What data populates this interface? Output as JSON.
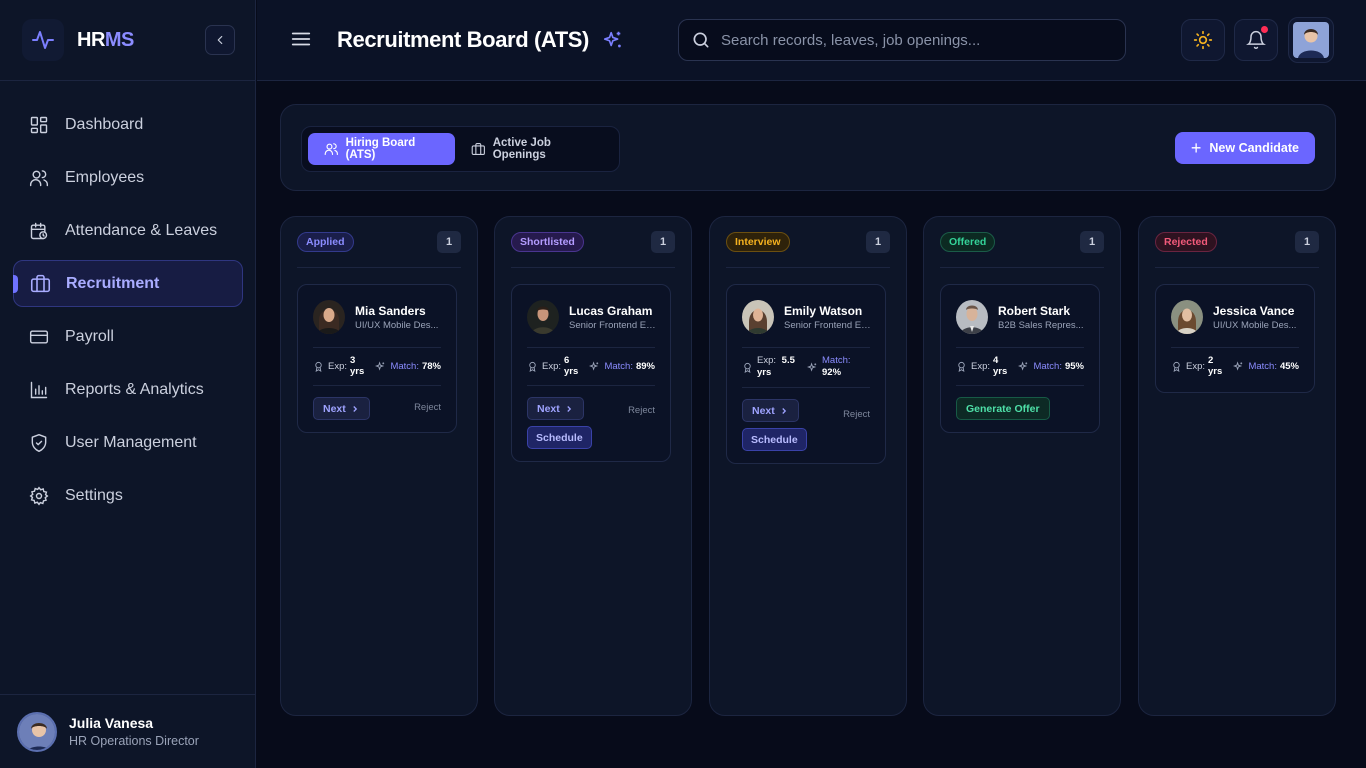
{
  "brand": {
    "prefix": "HR",
    "suffix": "MS"
  },
  "sidebar": {
    "items": [
      {
        "label": "Dashboard",
        "icon": "dashboard-icon"
      },
      {
        "label": "Employees",
        "icon": "users-icon"
      },
      {
        "label": "Attendance & Leaves",
        "icon": "calendar-icon"
      },
      {
        "label": "Recruitment",
        "icon": "briefcase-icon",
        "active": true
      },
      {
        "label": "Payroll",
        "icon": "credit-card-icon"
      },
      {
        "label": "Reports & Analytics",
        "icon": "bar-chart-icon"
      },
      {
        "label": "User Management",
        "icon": "shield-icon"
      },
      {
        "label": "Settings",
        "icon": "gear-icon"
      }
    ],
    "user": {
      "name": "Julia Vanesa",
      "role": "HR Operations Director"
    }
  },
  "header": {
    "title": "Recruitment Board (ATS)",
    "search_placeholder": "Search records, leaves, job openings..."
  },
  "toolbar": {
    "tabs": [
      {
        "label": "Hiring Board (ATS)",
        "active": true
      },
      {
        "label": "Active Job Openings",
        "active": false
      }
    ],
    "new_button": "New Candidate"
  },
  "columns": [
    {
      "label": "Applied",
      "count": "1",
      "color": "#6b70ff",
      "cards": [
        {
          "name": "Mia Sanders",
          "role": "UI/UX Mobile Des...",
          "exp_label": "Exp:",
          "exp": "3 yrs",
          "match_label": "Match:",
          "match": "78%",
          "next": "Next",
          "reject": "Reject"
        }
      ]
    },
    {
      "label": "Shortlisted",
      "count": "1",
      "color": "#a07cff",
      "cards": [
        {
          "name": "Lucas Graham",
          "role": "Senior Frontend En...",
          "exp_label": "Exp:",
          "exp": "6 yrs",
          "match_label": "Match:",
          "match": "89%",
          "next": "Next",
          "schedule": "Schedule",
          "reject": "Reject"
        }
      ]
    },
    {
      "label": "Interview",
      "count": "1",
      "color": "#f5b21f",
      "cards": [
        {
          "name": "Emily Watson",
          "role": "Senior Frontend En...",
          "exp_label": "Exp:",
          "exp": "5.5 yrs",
          "match_label": "Match:",
          "match": "92%",
          "next": "Next",
          "schedule": "Schedule",
          "reject": "Reject"
        }
      ]
    },
    {
      "label": "Offered",
      "count": "1",
      "color": "#34d399",
      "cards": [
        {
          "name": "Robert Stark",
          "role": "B2B Sales Repres...",
          "exp_label": "Exp:",
          "exp": "4 yrs",
          "match_label": "Match:",
          "match": "95%",
          "offer": "Generate Offer"
        }
      ]
    },
    {
      "label": "Rejected",
      "count": "1",
      "color": "#f25a7a",
      "cards": [
        {
          "name": "Jessica Vance",
          "role": "UI/UX Mobile Des...",
          "exp_label": "Exp:",
          "exp": "2 yrs",
          "match_label": "Match:",
          "match": "45%"
        }
      ]
    }
  ]
}
